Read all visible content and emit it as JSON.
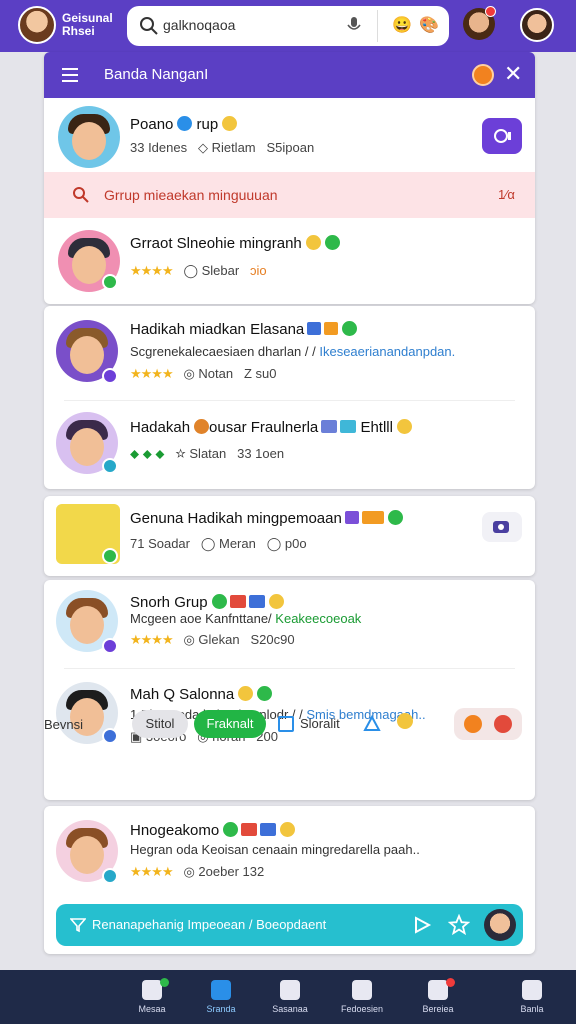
{
  "topbar": {
    "app_name": "Geisunal Rhsei",
    "search_value": "galknoqaoa"
  },
  "panel": {
    "title": "Banda NanganI"
  },
  "group_header": {
    "name": "Poano",
    "name_suffix": "rup",
    "meta1": "33 Idenes",
    "meta2": "Rietlam",
    "meta3": "S5ipoan"
  },
  "pinned": {
    "text": "Grrup mieaekan minguuuan",
    "count": "1⁄α"
  },
  "chats": [
    {
      "name": "Grraot Slneohie mingranh",
      "meta1": "Slebar",
      "meta2": "ɔio"
    },
    {
      "name": "Hadikah miadkan Elasana",
      "desc": "Scgrenekalecaesiaen dharlan / /",
      "desc_link": "Ikeseaerianandanpdan.",
      "meta1": "Notan",
      "meta2": "Z su0"
    },
    {
      "name": "Hadakah",
      "name2": "ousar Fraulnerla",
      "tag_text": "Ehtlll",
      "meta1": "Slatan",
      "meta2": "33 1oen"
    },
    {
      "name": "Genuna Hadikah mingpemoaan",
      "meta0": "71 Soadar",
      "meta1": "Meran",
      "meta2": "p0o"
    },
    {
      "name": "Snorh Grup",
      "desc": "Mcgeen aoe Kanfnttane/",
      "desc_link": "Keakeecoeoak",
      "meta1": "Glekan",
      "meta2": "S20c90"
    },
    {
      "name": "Mah Q Salonna",
      "desc": "1 Ekegooda kalandtaenlodr / /",
      "desc_link": "Smis bemdmagaah..",
      "meta0": "3oeoro",
      "meta1": "rioran",
      "meta2": "200"
    },
    {
      "name": "Hnogeakomo",
      "desc": "Hegran oda Keoisan cenaain mingredarella paah..",
      "meta1": "2oeber 132"
    }
  ],
  "action_row": {
    "label": "Bevnsi",
    "pill1": "Stitol",
    "pill2": "Fraknalt",
    "pill3": "Sloralit"
  },
  "cta": {
    "text": "Renanapehanig Impeoean / Boeopdaent"
  },
  "bottom_nav": [
    {
      "label": "Mesaa"
    },
    {
      "label": "Sranda"
    },
    {
      "label": "Sasanaa"
    },
    {
      "label": "Fedoesien"
    },
    {
      "label": "Bereiea"
    },
    {
      "label": "Banla"
    }
  ],
  "colors": {
    "primary": "#5b3fc4",
    "pinned_bg": "#fde3e6",
    "pinned_text": "#c0392b",
    "cta": "#26bfcf",
    "green_pill": "#22b545",
    "nav_bg": "#1f2a48"
  }
}
